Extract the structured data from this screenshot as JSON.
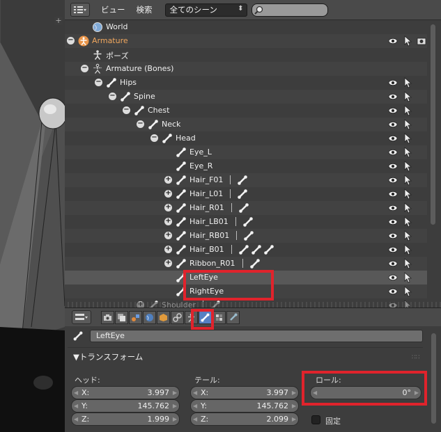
{
  "outliner_header": {
    "menu_view": "ビュー",
    "menu_search": "検索",
    "scene_select": "全てのシーン",
    "search_placeholder": ""
  },
  "outliner": {
    "rows": [
      {
        "label": "World",
        "icon": "world-icon",
        "expand": "",
        "orange": false
      },
      {
        "label": "Armature",
        "icon": "armature-object-icon",
        "expand": "−",
        "orange": true
      },
      {
        "label": "ポーズ",
        "icon": "pose-icon",
        "expand": "",
        "orange": false
      },
      {
        "label": "Armature (Bones)",
        "icon": "armature-data-icon",
        "expand": "−",
        "orange": false
      },
      {
        "label": "Hips",
        "icon": "bone-icon",
        "expand": "−",
        "orange": false
      },
      {
        "label": "Spine",
        "icon": "bone-icon",
        "expand": "−",
        "orange": false
      },
      {
        "label": "Chest",
        "icon": "bone-icon",
        "expand": "−",
        "orange": false
      },
      {
        "label": "Neck",
        "icon": "bone-icon",
        "expand": "−",
        "orange": false
      },
      {
        "label": "Head",
        "icon": "bone-icon",
        "expand": "−",
        "orange": false
      },
      {
        "label": "Eye_L",
        "icon": "bone-icon",
        "expand": "",
        "orange": false
      },
      {
        "label": "Eye_R",
        "icon": "bone-icon",
        "expand": "",
        "orange": false
      },
      {
        "label": "Hair_F01",
        "icon": "bone-icon",
        "expand": "+",
        "orange": false
      },
      {
        "label": "Hair_L01",
        "icon": "bone-icon",
        "expand": "+",
        "orange": false
      },
      {
        "label": "Hair_R01",
        "icon": "bone-icon",
        "expand": "+",
        "orange": false
      },
      {
        "label": "Hair_LB01",
        "icon": "bone-icon",
        "expand": "+",
        "orange": false
      },
      {
        "label": "Hair_RB01",
        "icon": "bone-icon",
        "expand": "+",
        "orange": false
      },
      {
        "label": "Hair_B01",
        "icon": "bone-icon",
        "expand": "+",
        "orange": false
      },
      {
        "label": "Ribbon_R01",
        "icon": "bone-icon",
        "expand": "+",
        "orange": false
      },
      {
        "label": "LeftEye",
        "icon": "bone-icon",
        "expand": "",
        "orange": false
      },
      {
        "label": "RightEye",
        "icon": "bone-icon",
        "expand": "",
        "orange": false
      },
      {
        "label": "Shoulder",
        "icon": "bone-icon",
        "expand": "+",
        "orange": false
      }
    ]
  },
  "properties": {
    "bone_name": "LeftEye",
    "panel_title": "▼トランスフォーム",
    "head_label": "ヘッド:",
    "tail_label": "テール:",
    "roll_label": "ロール:",
    "head": {
      "x_label": "X:",
      "x": "3.997",
      "y_label": "Y:",
      "y": "145.762",
      "z_label": "Z:",
      "z": "1.999"
    },
    "tail": {
      "x_label": "X:",
      "x": "3.997",
      "y_label": "Y:",
      "y": "145.762",
      "z_label": "Z:",
      "z": "2.099"
    },
    "roll": "0°",
    "lock_label": "固定"
  }
}
